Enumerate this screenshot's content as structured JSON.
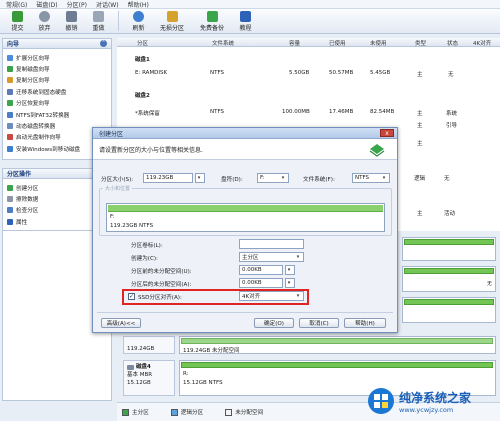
{
  "menu": [
    "常规(G)",
    "磁盘(D)",
    "分区(P)",
    "对话(W)",
    "帮助(H)"
  ],
  "toolbar": {
    "buttons": [
      "提交",
      "放弃",
      "撤销",
      "重做",
      "刷新",
      "无损分区",
      "免费备份",
      "教程"
    ]
  },
  "wizard_panel": {
    "title": "向导",
    "items": [
      "扩展分区向导",
      "复制磁盘向导",
      "复制分区向导",
      "迁移系统到固态硬盘",
      "分区恢复向导",
      "NTFS到FAT32转换器",
      "动态磁盘转换器",
      "启动光盘制作向导",
      "安装Windows到移动磁盘"
    ]
  },
  "ops_panel": {
    "title": "分区操作",
    "items": [
      "创建分区",
      "擦除数据",
      "检查分区",
      "属性"
    ]
  },
  "table": {
    "headers": [
      "分区",
      "文件系统",
      "容量",
      "已使用",
      "未使用",
      "类型",
      "状态",
      "4K对齐"
    ],
    "disk1_label": "磁盘1",
    "row1": [
      "E: RAMDISK",
      "NTFS",
      "5.50GB",
      "50.57MB",
      "5.45GB",
      "主",
      "无"
    ],
    "disk2_label": "磁盘2",
    "row2": [
      "*系统保留",
      "NTFS",
      "100.00MB",
      "17.46MB",
      "82.54MB",
      "主",
      "系统"
    ],
    "row3_type": "主",
    "row3_status": "引导",
    "row4_type": "主",
    "row5_type": "逻辑",
    "row5_status": "无",
    "row6_type": "主",
    "row6_status": "活动",
    "side_text": [
      "无",
      "无",
      "无",
      "无"
    ]
  },
  "dialog": {
    "title": "创建分区",
    "close_label": "x",
    "intro": "请设置新分区的大小与位置等相关信息.",
    "size_label": "分区大小(S):",
    "size_value": "119.23GB",
    "drive_label": "盘符(D):",
    "drive_value": "F:",
    "fs_label": "文件系统(F):",
    "fs_value": "NTFS",
    "map_header": "大小和位置",
    "map_drive": "F:",
    "map_size": "119.23GB NTFS",
    "label_label": "分区卷标(L):",
    "label_value": "",
    "create_as_label": "创建为(C):",
    "create_as_value": "主分区",
    "before_label": "分区前的未分配空间(U):",
    "before_value": "0.00KB",
    "after_label": "分区后的未分配空间(A):",
    "after_value": "0.00KB",
    "ssd_label": "SSD分区对齐(A):",
    "ssd_checked": true,
    "ssd_value": "4K对齐",
    "advanced_button": "高级(A)<<",
    "ok_button": "确定(O)",
    "cancel_button": "取消(C)",
    "help_button": "帮助(H)",
    "ok_glyph": "✓"
  },
  "disk_map": {
    "unalloc_size": "119.24GB",
    "unalloc_label": "119.24GB 未分配空间",
    "disk4_title": "磁盘4",
    "disk4_type": "基本 MBR",
    "disk4_size": "15.12GB",
    "disk4_part_drive": "R:",
    "disk4_part_size": "15.12GB NTFS"
  },
  "legend": [
    "主分区",
    "逻辑分区",
    "未分配空间"
  ],
  "watermark": {
    "title": "纯净系统之家",
    "url": "www.ycwjzy.com"
  },
  "colors": {
    "accent": "#2f6fc2",
    "primary_partition": "#3aa54a",
    "logical_partition": "#5aa3e0",
    "highlight_box": "#e02424"
  }
}
